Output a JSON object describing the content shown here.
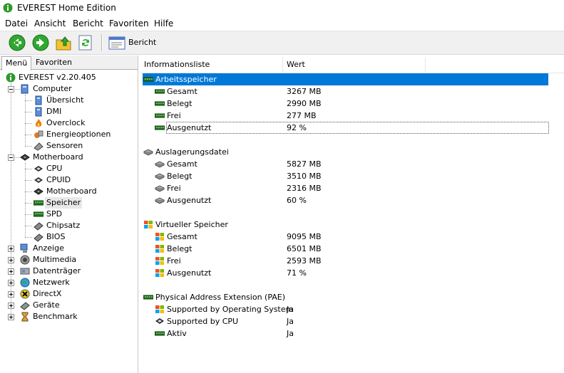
{
  "window": {
    "title": "EVEREST Home Edition"
  },
  "menu": [
    "Datei",
    "Ansicht",
    "Bericht",
    "Favoriten",
    "Hilfe"
  ],
  "toolbar": {
    "report_label": "Bericht"
  },
  "tabs": [
    "Menü",
    "Favoriten"
  ],
  "tree": {
    "root": "EVEREST v2.20.405",
    "computer": {
      "label": "Computer",
      "children": [
        "Übersicht",
        "DMI",
        "Overclock",
        "Energieoptionen",
        "Sensoren"
      ]
    },
    "motherboard": {
      "label": "Motherboard",
      "children": [
        "CPU",
        "CPUID",
        "Motherboard",
        "Speicher",
        "SPD",
        "Chipsatz",
        "BIOS"
      ]
    },
    "others": [
      "Anzeige",
      "Multimedia",
      "Datenträger",
      "Netzwerk",
      "DirectX",
      "Geräte",
      "Benchmark"
    ]
  },
  "list": {
    "col_item": "Informationsliste",
    "col_value": "Wert",
    "groups": [
      {
        "title": "Arbeitsspeicher",
        "rows": [
          {
            "k": "Gesamt",
            "v": "3267 MB"
          },
          {
            "k": "Belegt",
            "v": "2990 MB"
          },
          {
            "k": "Frei",
            "v": "277 MB"
          },
          {
            "k": "Ausgenutzt",
            "v": "92 %"
          }
        ]
      },
      {
        "title": "Auslagerungsdatei",
        "rows": [
          {
            "k": "Gesamt",
            "v": "5827 MB"
          },
          {
            "k": "Belegt",
            "v": "3510 MB"
          },
          {
            "k": "Frei",
            "v": "2316 MB"
          },
          {
            "k": "Ausgenutzt",
            "v": "60 %"
          }
        ]
      },
      {
        "title": "Virtueller Speicher",
        "rows": [
          {
            "k": "Gesamt",
            "v": "9095 MB"
          },
          {
            "k": "Belegt",
            "v": "6501 MB"
          },
          {
            "k": "Frei",
            "v": "2593 MB"
          },
          {
            "k": "Ausgenutzt",
            "v": "71 %"
          }
        ]
      },
      {
        "title": "Physical Address Extension (PAE)",
        "rows": [
          {
            "k": "Supported by Operating System",
            "v": "Ja"
          },
          {
            "k": "Supported by CPU",
            "v": "Ja"
          },
          {
            "k": "Aktiv",
            "v": "Ja"
          }
        ]
      }
    ]
  }
}
